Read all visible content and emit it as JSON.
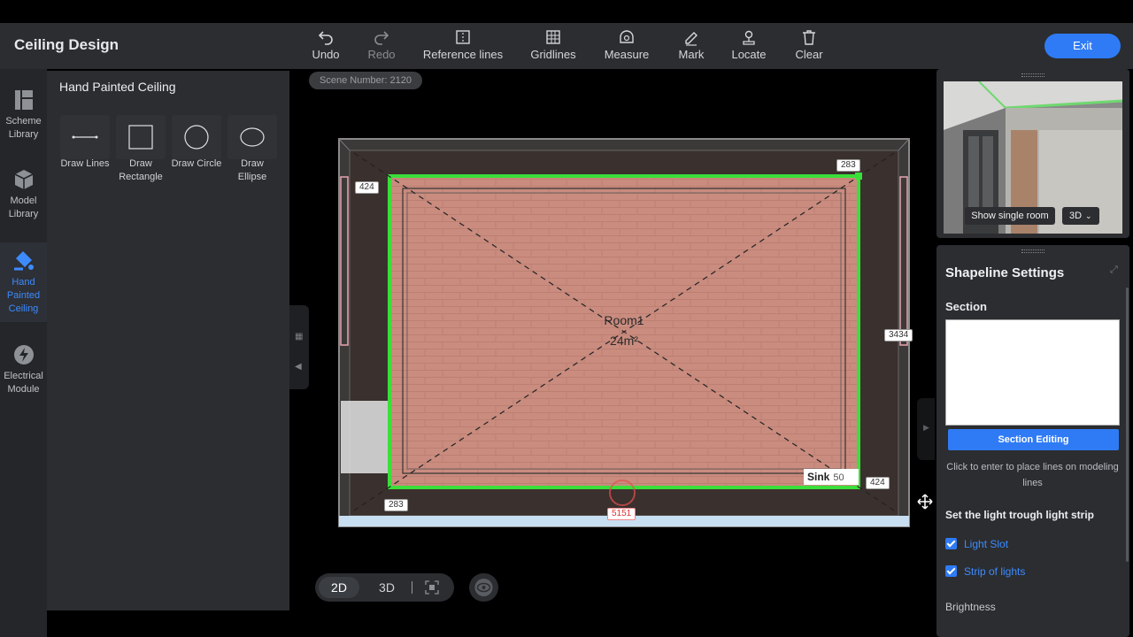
{
  "app": {
    "title": "Ceiling Design",
    "exit_label": "Exit"
  },
  "toolbar": [
    {
      "label": "Undo",
      "icon": "undo-icon"
    },
    {
      "label": "Redo",
      "icon": "redo-icon"
    },
    {
      "label": "Reference lines",
      "icon": "reference-lines-icon"
    },
    {
      "label": "Gridlines",
      "icon": "gridlines-icon"
    },
    {
      "label": "Measure",
      "icon": "measure-icon"
    },
    {
      "label": "Mark",
      "icon": "pen-icon"
    },
    {
      "label": "Locate",
      "icon": "locate-icon"
    },
    {
      "label": "Clear",
      "icon": "trash-icon"
    }
  ],
  "sidebar": {
    "items": [
      {
        "label": "Scheme Library",
        "icon": "scheme-library-icon"
      },
      {
        "label": "Model Library",
        "icon": "cube-icon"
      },
      {
        "label": "Hand Painted Ceiling",
        "icon": "paint-icon",
        "active": true
      },
      {
        "label": "Electrical Module",
        "icon": "lightning-icon"
      }
    ]
  },
  "panel": {
    "title": "Hand Painted Ceiling",
    "tools": [
      {
        "label": "Draw Lines",
        "icon": "line-icon"
      },
      {
        "label": "Draw Rectangle",
        "icon": "rectangle-icon"
      },
      {
        "label": "Draw Circle",
        "icon": "circle-icon"
      },
      {
        "label": "Draw Ellipse",
        "icon": "ellipse-icon"
      }
    ]
  },
  "canvas": {
    "scene_number": "Scene Number: 2120",
    "room_name": "Room1",
    "room_area": "24m²",
    "sink_label": "Sink",
    "sink_value": "50",
    "dimensions": {
      "top_right": "283",
      "left_top": "424",
      "right_mid": "3434",
      "right_bottom": "424",
      "bottom_left": "283",
      "bottom_mid": "5151"
    },
    "view_2d": "2D",
    "view_3d": "3D"
  },
  "preview": {
    "show_single_room": "Show single room",
    "mode": "3D"
  },
  "settings": {
    "title": "Shapeline Settings",
    "section_label": "Section",
    "section_editing": "Section Editing",
    "hint": "Click to enter to place lines on modeling lines",
    "light_heading": "Set the light trough light strip",
    "light_slot": "Light Slot",
    "strip_of_lights": "Strip of lights",
    "brightness": "Brightness"
  },
  "colors": {
    "accent": "#2f7bf5",
    "room_outline": "#3adf3a",
    "floor": "#c78a7c"
  }
}
